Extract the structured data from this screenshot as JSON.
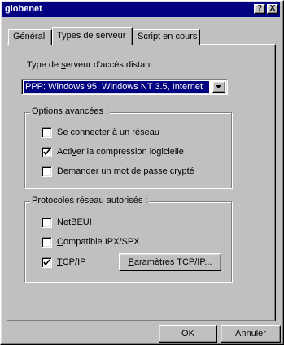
{
  "window": {
    "title": "globenet",
    "help_btn": "?",
    "close_btn": "X"
  },
  "tabs": [
    {
      "label": "Général"
    },
    {
      "label": "Types de serveur"
    },
    {
      "label": "Script en cours"
    }
  ],
  "server_type": {
    "label_pre": "Type de ",
    "label_u": "s",
    "label_post": "erveur d'accès distant  :",
    "value": "PPP: Windows 95, Windows NT 3.5, Internet"
  },
  "advanced_options": {
    "legend": "Options avancées :",
    "items": [
      {
        "pre": "Se connecte",
        "u": "r",
        "post": " à un réseau",
        "checked": false
      },
      {
        "pre": "Acti",
        "u": "v",
        "post": "er la compression logicielle",
        "checked": true
      },
      {
        "pre": "",
        "u": "D",
        "post": "emander un mot de passe crypté",
        "checked": false
      }
    ]
  },
  "protocols": {
    "legend": "Protocoles réseau autorisés :",
    "items": [
      {
        "pre": "",
        "u": "N",
        "post": "etBEUI",
        "checked": false
      },
      {
        "pre": "",
        "u": "C",
        "post": "ompatible IPX/SPX",
        "checked": false
      },
      {
        "pre": "",
        "u": "T",
        "post": "CP/IP",
        "checked": true
      }
    ],
    "tcpip_settings_u": "P",
    "tcpip_settings_rest": "aramètres TCP/IP..."
  },
  "buttons": {
    "ok": "OK",
    "cancel": "Annuler"
  }
}
